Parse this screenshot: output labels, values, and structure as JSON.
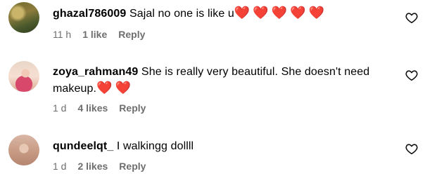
{
  "comments": [
    {
      "username": "ghazal786009",
      "text": "Sajal no one is like u",
      "emoji": "❤️❤️❤️❤️❤️",
      "time": "11 h",
      "likes": "1 like",
      "reply": "Reply",
      "like_icon": "heart-outline-icon"
    },
    {
      "username": "zoya_rahman49",
      "text": "She is really very beautiful. She doesn't need makeup.",
      "emoji": "❤️❤️",
      "time": "1 d",
      "likes": "4 likes",
      "reply": "Reply",
      "like_icon": "heart-outline-icon"
    },
    {
      "username": "qundeelqt_",
      "text": "I walkingg dollll",
      "emoji": "",
      "time": "1 d",
      "likes": "2 likes",
      "reply": "Reply",
      "like_icon": "heart-outline-icon"
    }
  ]
}
